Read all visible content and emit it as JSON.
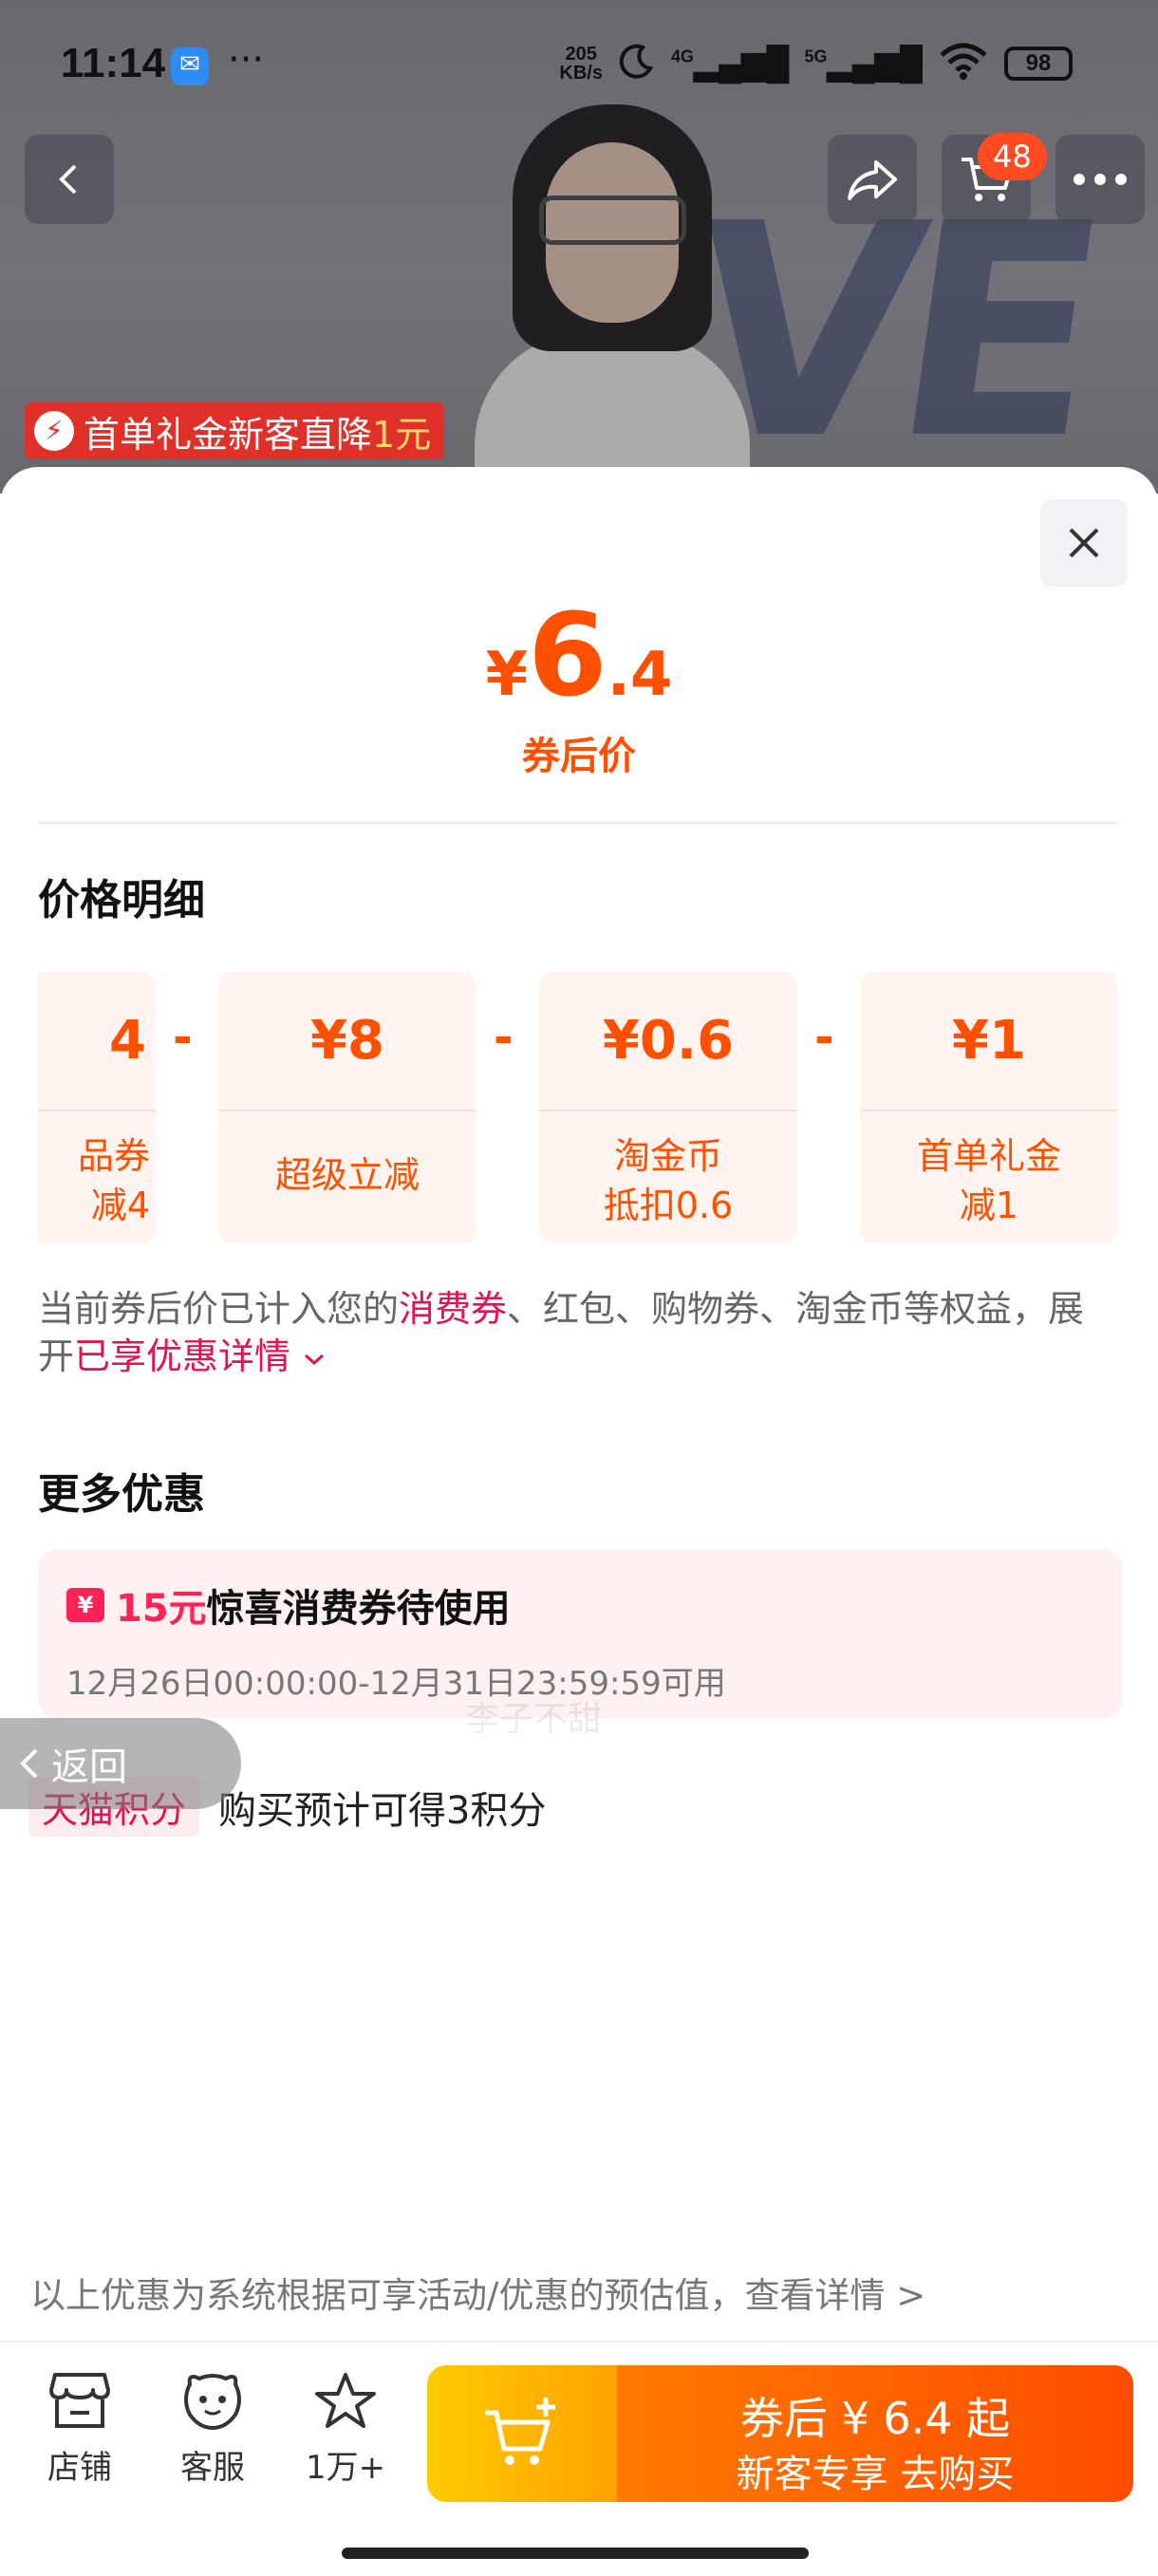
{
  "status_bar": {
    "time": "11:14",
    "speed_value": "205",
    "speed_unit": "KB/s",
    "network_1": "4G",
    "network_2": "5G",
    "battery": "98"
  },
  "hero": {
    "cart_badge": "48",
    "promo_text": "首单礼金新客直降",
    "promo_amount": "1元",
    "deco_text": "VE"
  },
  "sheet": {
    "price_currency": "¥",
    "price_integer": "6",
    "price_decimal": ".4",
    "price_label": "券后价",
    "detail_title": "价格明细",
    "cards": [
      {
        "amount": "4",
        "label_1": "品券",
        "label_2": "减4"
      },
      {
        "amount": "¥8",
        "label_1": "超级立减",
        "label_2": ""
      },
      {
        "amount": "¥0.6",
        "label_1": "淘金币",
        "label_2": "抵扣0.6"
      },
      {
        "amount": "¥1",
        "label_1": "首单礼金",
        "label_2": "减1"
      }
    ],
    "operator": "-",
    "note_part1": "当前券后价已计入您的",
    "note_red1": "消费券",
    "note_part2": "、红包、购物券、淘金币等权益，展开",
    "note_red2": "已享优惠详情",
    "more_title": "更多优惠",
    "coupon_icon": "¥",
    "coupon_amount": "15元",
    "coupon_title": "惊喜消费券待使用",
    "coupon_date": "12月26日00:00:00-12月31日23:59:59可用",
    "points_tag": "天猫积分",
    "points_text": "购买预计可得3积分",
    "watermark": "李子不甜",
    "back_label": "返回",
    "disclaimer": "以上优惠为系统根据可享活动/优惠的预估值，查看详情 >"
  },
  "bottom_bar": {
    "shop_label": "店铺",
    "service_label": "客服",
    "fav_label": "1万+",
    "buy_line1": "券后 ¥ 6.4 起",
    "buy_line2": "新客专享  去购买"
  },
  "colors": {
    "accent": "#ff5000",
    "red_highlight": "#e4134e",
    "buy_gradient_start": "#ffcb00",
    "buy_gradient_end": "#ff4c00"
  }
}
